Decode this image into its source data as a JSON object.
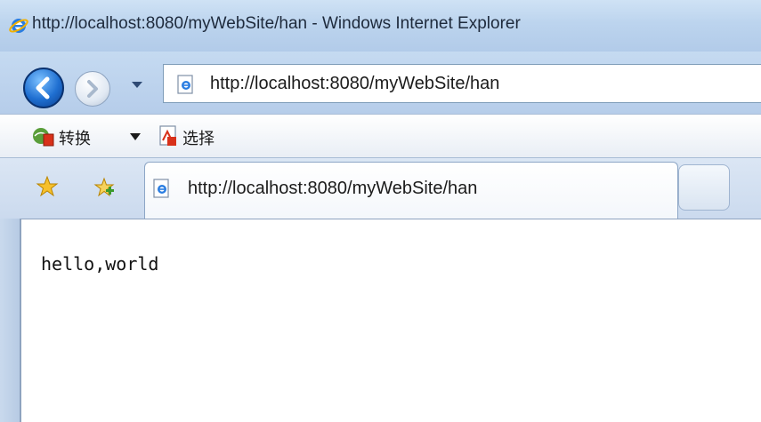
{
  "window": {
    "title": "http://localhost:8080/myWebSite/han - Windows Internet Explorer"
  },
  "navigation": {
    "address": "http://localhost:8080/myWebSite/han"
  },
  "commandbar": {
    "convert_label": "转换",
    "select_label": "选择"
  },
  "tabs": [
    {
      "label": "http://localhost:8080/myWebSite/han",
      "active": true
    }
  ],
  "page": {
    "body_text": "hello,world"
  }
}
